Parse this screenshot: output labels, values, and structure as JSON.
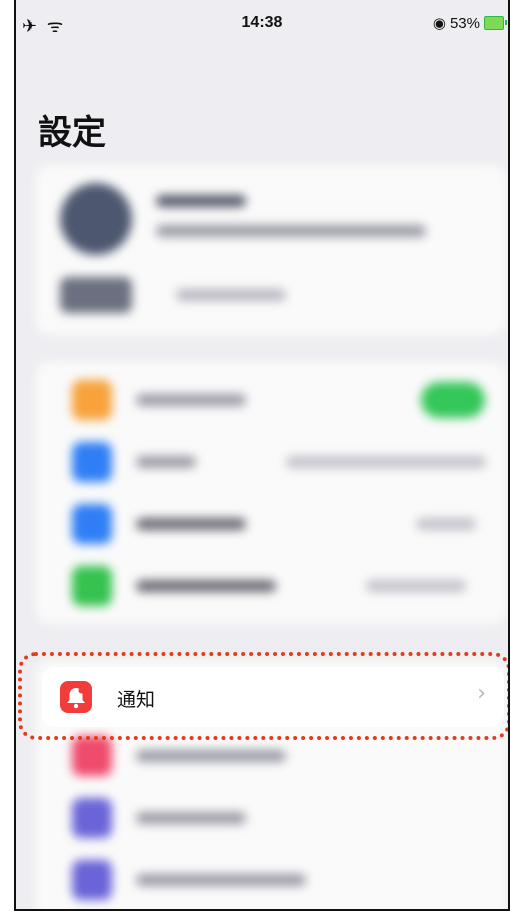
{
  "status_bar": {
    "left_icons": "✈ ᯤ",
    "time": "14:38",
    "lock_icon": "◉",
    "battery_percent": "53%"
  },
  "page_title": "設定",
  "notifications_row": {
    "label": "通知",
    "chevron": "›"
  },
  "colors": {
    "highlight": "#e23b1f",
    "notification_icon": "#f23b3b",
    "toggle_on": "#34c759"
  },
  "blurred_icons": [
    "orange",
    "blue",
    "blue",
    "green",
    "pink",
    "indigo",
    "indigo"
  ]
}
